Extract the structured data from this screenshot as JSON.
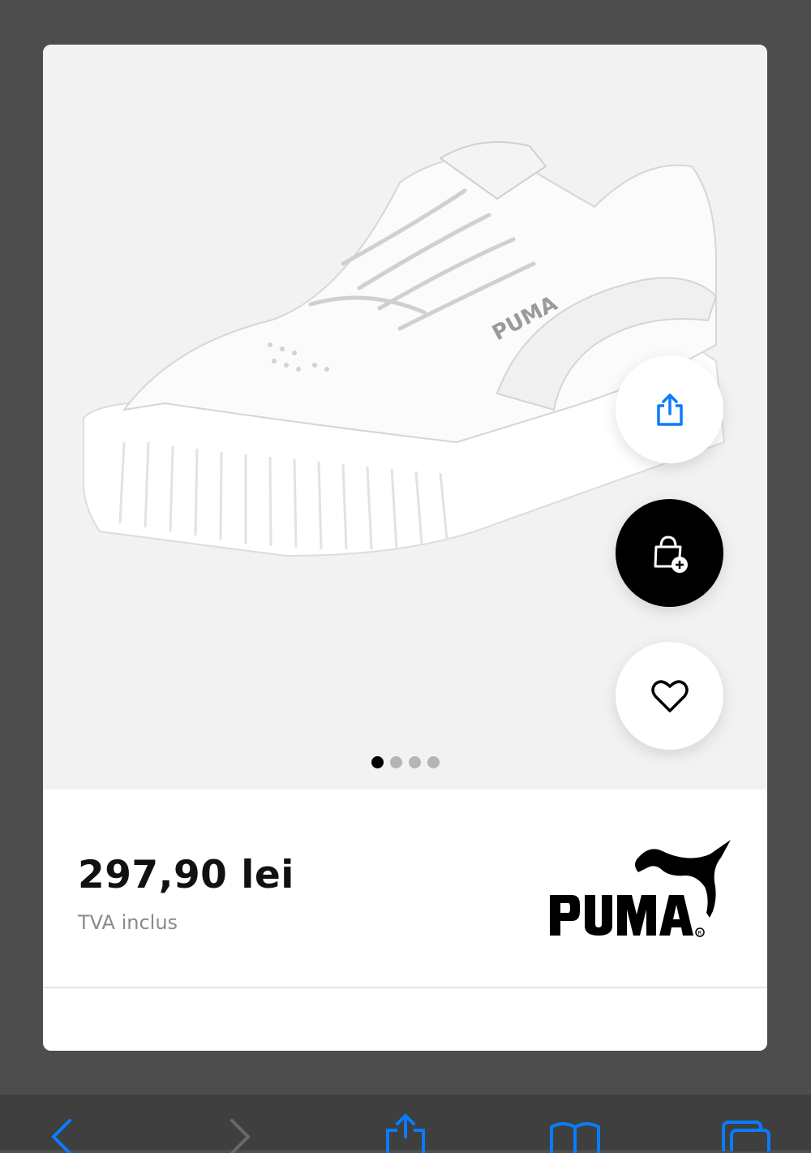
{
  "product": {
    "image_alt": "Puma white sneaker",
    "price": "297,90 lei",
    "vat_note": "TVA inclus",
    "brand": "PUMA",
    "gallery": {
      "total": 4,
      "active": 1
    }
  },
  "actions": {
    "share_icon": "share-icon",
    "add_to_bag_icon": "bag-plus-icon",
    "wishlist_icon": "heart-icon"
  },
  "browser_toolbar": {
    "icons": [
      "back-icon",
      "forward-icon",
      "share-icon",
      "bookmarks-icon",
      "tabs-icon"
    ]
  },
  "colors": {
    "accent": "#0a7cff",
    "background": "#4d4d4d",
    "image_bg": "#f2f2f3",
    "cta_dark": "#000000"
  }
}
